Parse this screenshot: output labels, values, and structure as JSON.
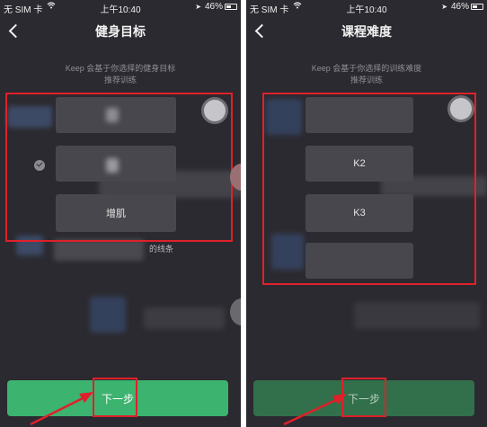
{
  "screens": [
    {
      "status": {
        "carrier": "无 SIM 卡",
        "time": "上午10:40",
        "battery": "46%"
      },
      "title": "健身目标",
      "subtitle_line1": "Keep 会基于你选择的健身目标",
      "subtitle_line2": "推荐训练",
      "options": [
        "",
        "",
        "增肌"
      ],
      "hint": "的线条",
      "next_label": "下一步"
    },
    {
      "status": {
        "carrier": "无 SIM 卡",
        "time": "上午10:40",
        "battery": "46%"
      },
      "title": "课程难度",
      "subtitle_line1": "Keep 会基于你选择的训练难度",
      "subtitle_line2": "推荐训练",
      "options": [
        "",
        "K2",
        "K3",
        ""
      ],
      "next_label": "下一步"
    }
  ],
  "colors": {
    "screen_bg": "#2b2a30",
    "option_bg": "#48474d",
    "next_enabled": "#3cb36e",
    "next_dimmed": "#31704a",
    "annotation": "#e0202a"
  },
  "icons": [
    "back-chevron-icon",
    "wifi-icon",
    "location-icon",
    "battery-icon",
    "check-circle-icon",
    "toggle-knob-icon"
  ]
}
